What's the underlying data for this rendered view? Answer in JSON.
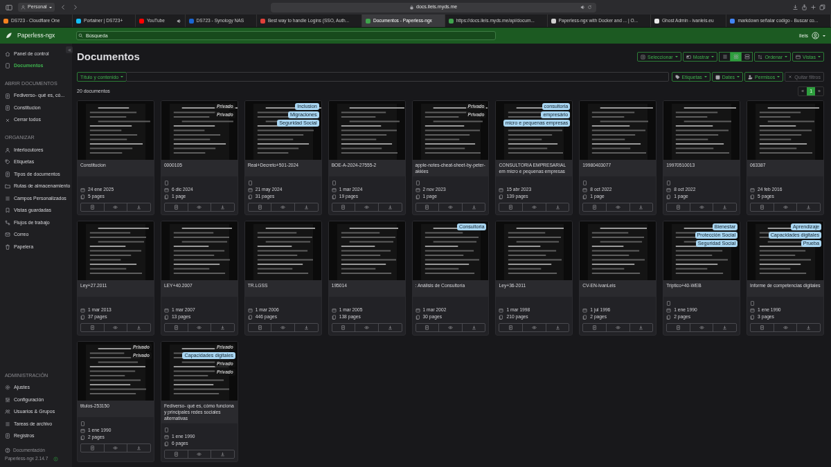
{
  "browser": {
    "profile": "Personal",
    "address": "docs.ileis.myds.me",
    "tabs": [
      {
        "title": "DS723 - Cloudflare One",
        "selected": false,
        "audio": false,
        "color": "#f48120"
      },
      {
        "title": "Portainer | DS723+",
        "selected": false,
        "audio": false,
        "color": "#13bef9"
      },
      {
        "title": "YouTube",
        "selected": false,
        "audio": true,
        "color": "#ff0000"
      },
      {
        "title": "DS723 - Synology NAS",
        "selected": false,
        "audio": false,
        "color": "#1a66d2"
      },
      {
        "title": "Best way to handle Logins (SSO, Auth...",
        "selected": false,
        "audio": false,
        "color": "#e0403a"
      },
      {
        "title": "Documentos - Paperless-ngx",
        "selected": true,
        "audio": false,
        "color": "#3fa34d"
      },
      {
        "title": "https://docs.ileis.myds.me/api/docum...",
        "selected": false,
        "audio": false,
        "color": "#3fa34d"
      },
      {
        "title": "Paperless-ngx with Docker and ... | O...",
        "selected": false,
        "audio": false,
        "color": "#d0d0d0"
      },
      {
        "title": "Ghost Admin - ivanleis.eu",
        "selected": false,
        "audio": false,
        "color": "#e8e8e8"
      },
      {
        "title": "markdown señalar codigo - Buscar co...",
        "selected": false,
        "audio": false,
        "color": "#4285f4"
      }
    ]
  },
  "app": {
    "brand": "Paperless-ngx",
    "search": {
      "placeholder": "Búsqueda"
    },
    "user": "ileis"
  },
  "sidebar": {
    "items": [
      {
        "label": "Panel de control",
        "selected": false
      },
      {
        "label": "Documentos",
        "selected": true
      }
    ],
    "sections": [
      {
        "title": "ABRIR DOCUMENTOS",
        "items": [
          {
            "label": "Fediverso- qué es, có...",
            "selected": false
          },
          {
            "label": "Constitucion",
            "selected": false
          },
          {
            "label": "Cerrar todos",
            "selected": false
          }
        ]
      },
      {
        "title": "ORGANIZAR",
        "items": [
          {
            "label": "Interlocutores",
            "selected": false
          },
          {
            "label": "Etiquetas",
            "selected": false
          },
          {
            "label": "Tipos de documentos",
            "selected": false
          },
          {
            "label": "Rutas de almacenamiento",
            "selected": false
          },
          {
            "label": "Campos Personalizados",
            "selected": false
          },
          {
            "label": "Vistas guardadas",
            "selected": false
          },
          {
            "label": "Flujos de trabajo",
            "selected": false
          },
          {
            "label": "Correo",
            "selected": false
          },
          {
            "label": "Papelera",
            "selected": false
          }
        ]
      },
      {
        "title": "ADMINISTRACIÓN",
        "items": [
          {
            "label": "Ajustes",
            "selected": false
          },
          {
            "label": "Configuración",
            "selected": false
          },
          {
            "label": "Usuarios & Grupos",
            "selected": false
          },
          {
            "label": "Tareas de archivo",
            "selected": false
          },
          {
            "label": "Registros",
            "selected": false
          }
        ]
      }
    ],
    "footer": {
      "docs_link": "Documentación",
      "version": "Paperless-ngx 2.14.7"
    }
  },
  "page": {
    "title": "Documentos",
    "toolbar": {
      "select": "Seleccionar",
      "display": "Mostrar",
      "view_modes": [
        {
          "selected": false
        },
        {
          "selected": true
        },
        {
          "selected": false
        }
      ],
      "sort": "Ordenar",
      "views": "Vistas"
    },
    "filters": {
      "field_select": "Título y contenido",
      "tags": "Etiquetas",
      "dates": "Dates",
      "permissions": "Permisos",
      "clear": {
        "label": "Quitar filtros",
        "disabled": true
      }
    },
    "count": "20 documentos",
    "pagination": {
      "prev": "«",
      "pages": [
        {
          "label": "1",
          "selected": true
        }
      ],
      "next": "»"
    }
  },
  "documents": [
    {
      "title": "Constitucion",
      "has_type": false,
      "date": "24 ene 2025",
      "pages": "5 pages"
    },
    {
      "title": "0000105",
      "has_type": true,
      "date": "6 dic 2024",
      "pages": "1 page",
      "tags": [
        {
          "text": "Privado",
          "kind": "private"
        },
        {
          "text": "Privado",
          "kind": "private"
        }
      ]
    },
    {
      "title": "Real+Decreto+501-2024",
      "has_type": true,
      "date": "21 may 2024",
      "pages": "31 pages",
      "tags": [
        {
          "text": "Inclusion",
          "kind": "tag"
        },
        {
          "text": "Migraciones",
          "kind": "tag"
        },
        {
          "text": "Seguridad Social",
          "kind": "tag"
        }
      ]
    },
    {
      "title": "BOE-A-2024-27555-2",
      "has_type": true,
      "date": "1 mar 2024",
      "pages": "19 pages"
    },
    {
      "title": "apple-notes-cheat-sheet-by-peter-akkies",
      "has_type": true,
      "date": "2 nov 2023",
      "pages": "1 page",
      "tags": [
        {
          "text": "Privado",
          "kind": "private"
        },
        {
          "text": "Privado",
          "kind": "private"
        }
      ]
    },
    {
      "title": "CONSULTORIA EMPRESARIAL em micro e pequenas empresas",
      "has_type": false,
      "date": "15 abr 2023",
      "pages": "139 pages",
      "tags": [
        {
          "text": "consultoria",
          "kind": "tag"
        },
        {
          "text": "empresário",
          "kind": "tag"
        },
        {
          "text": "micro e pequenas empresas",
          "kind": "tag"
        }
      ]
    },
    {
      "title": "19980403077",
      "has_type": true,
      "date": "8 oct 2022",
      "pages": "1 page"
    },
    {
      "title": "19970510013",
      "has_type": true,
      "date": "8 oct 2022",
      "pages": "1 page"
    },
    {
      "title": "063387",
      "has_type": false,
      "date": "24 feb 2016",
      "pages": "5 pages"
    },
    {
      "title": "Ley+27.2011",
      "has_type": false,
      "date": "1 mar 2013",
      "pages": "37 pages"
    },
    {
      "title": "LEY+40.2007",
      "has_type": false,
      "date": "1 mar 2007",
      "pages": "13 pages"
    },
    {
      "title": "TR.LGSS",
      "has_type": false,
      "date": "1 mar 2006",
      "pages": "446 pages"
    },
    {
      "title": "195014",
      "has_type": false,
      "date": "1 mar 2005",
      "pages": "138 pages"
    },
    {
      "title": ": Análisis de Consultoría",
      "has_type": false,
      "date": "1 mar 2002",
      "pages": "30 pages",
      "tags": [
        {
          "text": "Consultoria",
          "kind": "tag"
        }
      ]
    },
    {
      "title": "Ley+36-2011",
      "has_type": false,
      "date": "1 mar 1998",
      "pages": "210 pages"
    },
    {
      "title": "CV-EN-IvanLeis",
      "has_type": false,
      "date": "1 jul 1996",
      "pages": "2 pages"
    },
    {
      "title": "Triptico+40-WEB",
      "has_type": true,
      "date": "1 ene 1990",
      "pages": "2 pages",
      "tags": [
        {
          "text": "Bienestar",
          "kind": "tag"
        },
        {
          "text": "Protección Social",
          "kind": "tag"
        },
        {
          "text": "Seguridad Social",
          "kind": "tag"
        }
      ]
    },
    {
      "title": "Informe de competencias digitales",
      "has_type": true,
      "date": "1 ene 1990",
      "pages": "3 pages",
      "tags": [
        {
          "text": "Aprendizaje",
          "kind": "tag"
        },
        {
          "text": "Capacidades digitales",
          "kind": "tag"
        },
        {
          "text": "Prueba",
          "kind": "tag"
        }
      ]
    },
    {
      "title": "titulos-253150",
      "has_type": true,
      "date": "1 ene 1990",
      "pages": "2 pages",
      "tags": [
        {
          "text": "Privado",
          "kind": "private"
        },
        {
          "text": "Privado",
          "kind": "private"
        }
      ]
    },
    {
      "title": "Fediverso- qué es, cómo funciona y principales redes sociales alternativas",
      "has_type": true,
      "date": "1 ene 1990",
      "pages": "6 pages",
      "tags": [
        {
          "text": "Privado",
          "kind": "private"
        },
        {
          "text": "Capacidades digitales",
          "kind": "tag"
        },
        {
          "text": "Privado",
          "kind": "private"
        },
        {
          "text": "Privado",
          "kind": "private"
        }
      ]
    }
  ]
}
